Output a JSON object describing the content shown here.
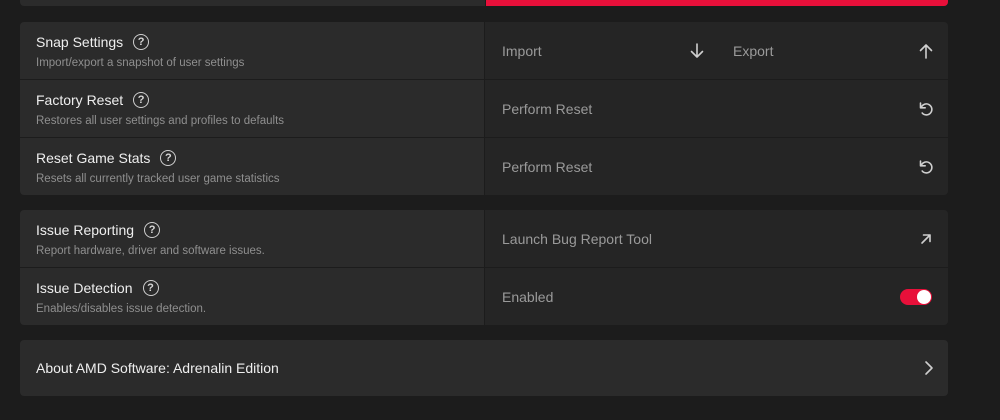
{
  "colors": {
    "accent": "#e8103a",
    "panel": "#2b2b2b",
    "panel_right": "#252525",
    "background": "#1c1c1c"
  },
  "group1": {
    "snap": {
      "title": "Snap Settings",
      "description": "Import/export a snapshot of user settings",
      "import_label": "Import",
      "export_label": "Export",
      "import_icon": "arrow-down-icon",
      "export_icon": "arrow-up-icon"
    },
    "factory": {
      "title": "Factory Reset",
      "description": "Restores all user settings and profiles to defaults",
      "action_label": "Perform Reset",
      "action_icon": "reset-icon"
    },
    "game_stats": {
      "title": "Reset Game Stats",
      "description": "Resets all currently tracked user game statistics",
      "action_label": "Perform Reset",
      "action_icon": "reset-icon"
    }
  },
  "group2": {
    "issue_reporting": {
      "title": "Issue Reporting",
      "description": "Report hardware, driver and software issues.",
      "action_label": "Launch Bug Report Tool",
      "action_icon": "external-link-icon"
    },
    "issue_detection": {
      "title": "Issue Detection",
      "description": "Enables/disables issue detection.",
      "status_label": "Enabled",
      "toggle_on": true
    }
  },
  "about": {
    "label": "About AMD Software: Adrenalin Edition",
    "icon": "chevron-right-icon"
  },
  "help_glyph": "?"
}
